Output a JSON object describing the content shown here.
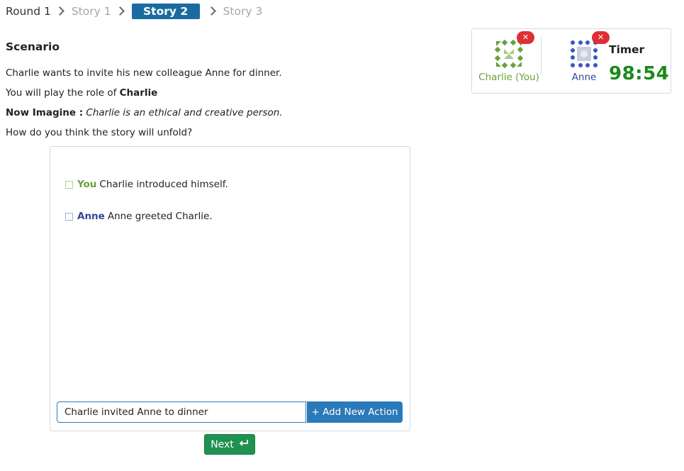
{
  "breadcrumb": {
    "items": [
      {
        "label": "Round 1",
        "state": "done"
      },
      {
        "label": "Story 1",
        "state": "muted"
      },
      {
        "label": "Story 2",
        "state": "active"
      },
      {
        "label": "Story 3",
        "state": "muted"
      }
    ]
  },
  "scenario": {
    "title": "Scenario",
    "description": "Charlie wants to invite his new colleague Anne for dinner.",
    "role_prefix": "You will play the role of ",
    "role_name": "Charlie",
    "imagine_label": "Now Imagine :",
    "imagine_text": "Charlie is an ethical and creative person.",
    "question": "How do you think the story will unfold?"
  },
  "story": {
    "entries": [
      {
        "actor": "You",
        "text": "Charlie introduced himself.",
        "icon": "green-dotted-square-icon"
      },
      {
        "actor": "Anne",
        "text": "Anne greeted Charlie.",
        "icon": "blue-dotted-square-icon"
      }
    ],
    "input_value": "Charlie invited Anne to dinner",
    "add_button_label": "+ Add New Action"
  },
  "next_button": {
    "label": "Next",
    "icon": "return-arrow-icon"
  },
  "players": [
    {
      "name": "Charlie (You)",
      "color": "#6aa13a",
      "remove_glyph": "✕"
    },
    {
      "name": "Anne",
      "color": "#33479b",
      "remove_glyph": "✕"
    }
  ],
  "timer": {
    "label": "Timer",
    "value": "98:54",
    "color": "#1b8a1b"
  },
  "colors": {
    "accent": "#1a6ba0",
    "add_button": "#2a79b8",
    "next_button": "#1f9150",
    "remove_badge": "#e02e35"
  }
}
